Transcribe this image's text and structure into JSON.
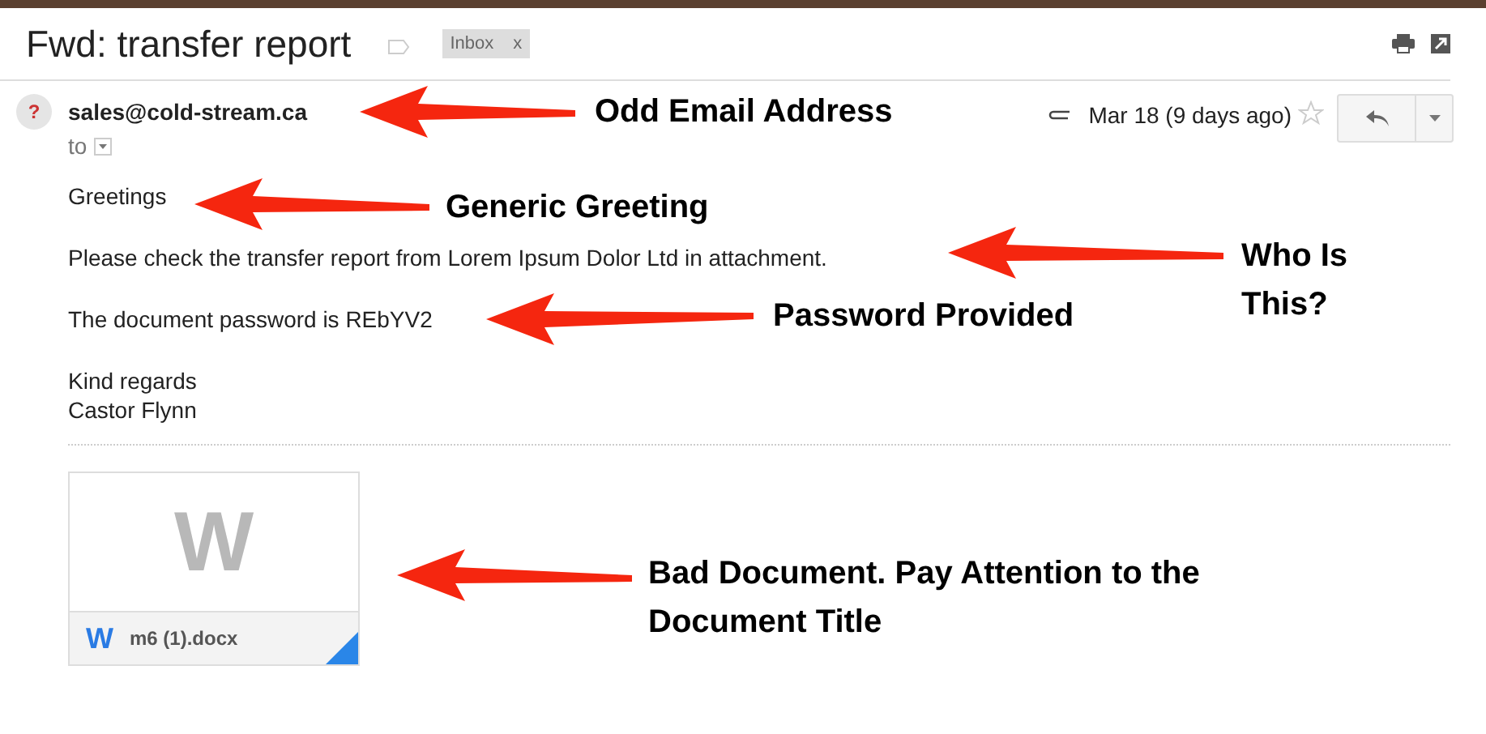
{
  "message": {
    "subject": "Fwd: transfer report",
    "label": {
      "text": "Inbox",
      "remove": "x"
    },
    "avatar": "?",
    "sender": "sales@cold-stream.ca",
    "date": "Mar 18 (9 days ago)",
    "starred": false,
    "to": "to",
    "body": [
      "Greetings",
      "Please check the transfer report from Lorem Ipsum Dolor Ltd in attachment.",
      "The document password is REbYV2"
    ],
    "signature": [
      "Kind regards",
      "Castor Flynn"
    ],
    "attachment": {
      "glyph": "W",
      "file_glyph": "W",
      "name": "m6 (1).docx"
    }
  },
  "annotations": [
    {
      "text": "Odd Email Address"
    },
    {
      "text": "Generic Greeting"
    },
    {
      "text": "Who Is This?"
    },
    {
      "text": "Password Provided"
    },
    {
      "text": "Bad Document. Pay Attention to the Document Title"
    }
  ]
}
